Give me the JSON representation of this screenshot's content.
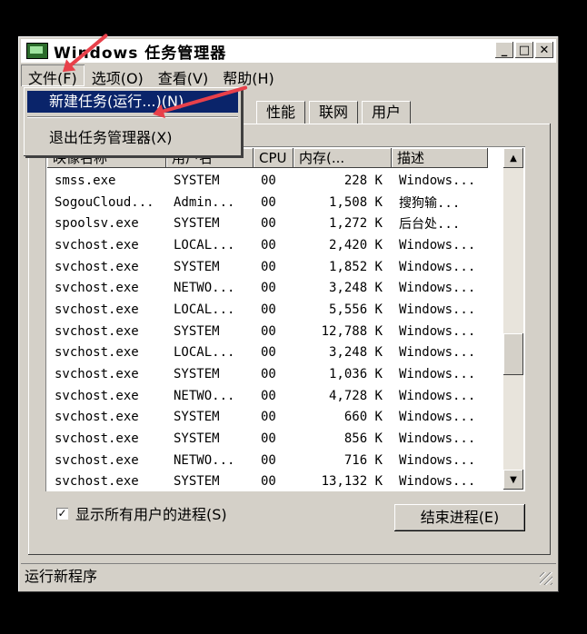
{
  "window": {
    "title": "Windows 任务管理器",
    "buttons": [
      "_",
      "□",
      "✕"
    ]
  },
  "menubar": {
    "file": "文件(F)",
    "options": "选项(O)",
    "view": "查看(V)",
    "help": "帮助(H)"
  },
  "file_menu": {
    "new_task": "新建任务(运行...)(N)",
    "exit": "退出任务管理器(X)"
  },
  "tabs": [
    "性能",
    "联网",
    "用户"
  ],
  "columns": {
    "image": "映像名称",
    "user": "用户名",
    "cpu": "CPU",
    "mem": "内存(...",
    "desc": "描述"
  },
  "processes": [
    [
      "smss.exe",
      "SYSTEM",
      "00",
      "228 K",
      "Windows..."
    ],
    [
      "SogouCloud...",
      "Admin...",
      "00",
      "1,508 K",
      "搜狗输..."
    ],
    [
      "spoolsv.exe",
      "SYSTEM",
      "00",
      "1,272 K",
      "后台处..."
    ],
    [
      "svchost.exe",
      "LOCAL...",
      "00",
      "2,420 K",
      "Windows..."
    ],
    [
      "svchost.exe",
      "SYSTEM",
      "00",
      "1,852 K",
      "Windows..."
    ],
    [
      "svchost.exe",
      "NETWO...",
      "00",
      "3,248 K",
      "Windows..."
    ],
    [
      "svchost.exe",
      "LOCAL...",
      "00",
      "5,556 K",
      "Windows..."
    ],
    [
      "svchost.exe",
      "SYSTEM",
      "00",
      "12,788 K",
      "Windows..."
    ],
    [
      "svchost.exe",
      "LOCAL...",
      "00",
      "3,248 K",
      "Windows..."
    ],
    [
      "svchost.exe",
      "SYSTEM",
      "00",
      "1,036 K",
      "Windows..."
    ],
    [
      "svchost.exe",
      "NETWO...",
      "00",
      "4,728 K",
      "Windows..."
    ],
    [
      "svchost.exe",
      "SYSTEM",
      "00",
      "660 K",
      "Windows..."
    ],
    [
      "svchost.exe",
      "SYSTEM",
      "00",
      "856 K",
      "Windows..."
    ],
    [
      "svchost.exe",
      "NETWO...",
      "00",
      "716 K",
      "Windows..."
    ],
    [
      "svchost.exe",
      "SYSTEM",
      "00",
      "13,132 K",
      "Windows..."
    ]
  ],
  "show_all_users": {
    "label": "显示所有用户的进程(S)",
    "checked": true,
    "mark": "✓"
  },
  "end_process_button": "结束进程(E)",
  "status": "运行新程序",
  "colors": {
    "highlight": "#0a246a",
    "annotation": "#e8404a",
    "face": "#d4d0c8"
  }
}
